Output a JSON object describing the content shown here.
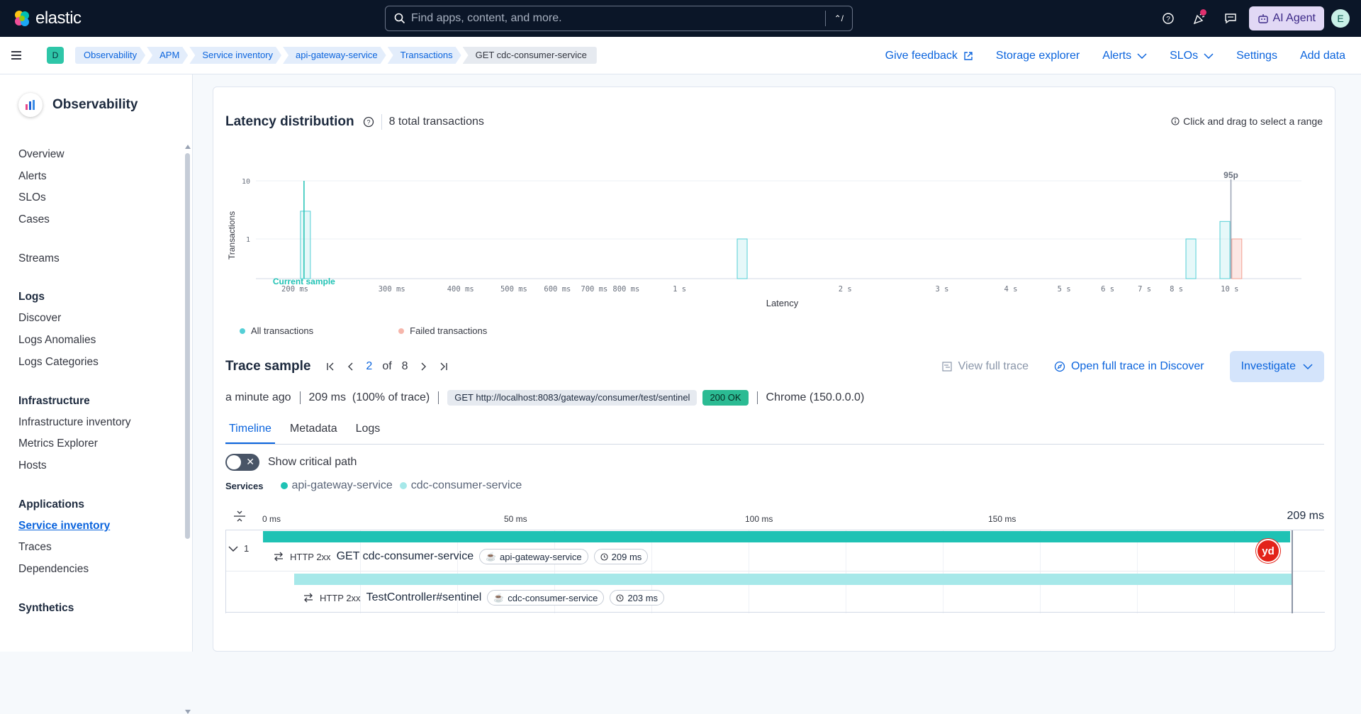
{
  "topbar": {
    "brand": "elastic",
    "search_placeholder": "Find apps, content, and more.",
    "search_shortcut": "⌃/",
    "ai_agent_label": "AI Agent",
    "avatar_initial": "E"
  },
  "subbar": {
    "space_initial": "D",
    "breadcrumbs": [
      "Observability",
      "APM",
      "Service inventory",
      "api-gateway-service",
      "Transactions",
      "GET cdc-consumer-service"
    ],
    "links": {
      "give_feedback": "Give feedback",
      "storage_explorer": "Storage explorer",
      "alerts": "Alerts",
      "slos": "SLOs",
      "settings": "Settings",
      "add_data": "Add data"
    }
  },
  "sidebar": {
    "title": "Observability",
    "items": {
      "overview": "Overview",
      "alerts": "Alerts",
      "slos": "SLOs",
      "cases": "Cases",
      "streams": "Streams",
      "logs_group": "Logs",
      "discover": "Discover",
      "logs_anomalies": "Logs Anomalies",
      "logs_categories": "Logs Categories",
      "infra_group": "Infrastructure",
      "infra_inventory": "Infrastructure inventory",
      "metrics_explorer": "Metrics Explorer",
      "hosts": "Hosts",
      "apps_group": "Applications",
      "service_inventory": "Service inventory",
      "traces": "Traces",
      "dependencies": "Dependencies",
      "synthetics_group": "Synthetics"
    }
  },
  "latency": {
    "title": "Latency distribution",
    "total": "8 total transactions",
    "hint": "Click and drag to select a range",
    "legend_all": "All transactions",
    "legend_failed": "Failed transactions"
  },
  "chart_data": {
    "type": "bar",
    "xlabel": "Latency",
    "ylabel": "Transactions",
    "y_scale": "log",
    "y_ticks": [
      "10",
      "1"
    ],
    "x_ticks": [
      "200 ms",
      "300 ms",
      "400 ms",
      "500 ms",
      "600 ms",
      "700 ms",
      "800 ms",
      "1 s",
      "2 s",
      "3 s",
      "4 s",
      "5 s",
      "6 s",
      "7 s",
      "8 s",
      "10 s"
    ],
    "annotations": {
      "current_sample": "Current sample",
      "percentile": "95p"
    },
    "series": [
      {
        "name": "All transactions",
        "color": "#54cfd6",
        "bins": [
          {
            "x_ms": 209,
            "count": 3
          },
          {
            "x_ms": 1300,
            "count": 1
          },
          {
            "x_ms": 8500,
            "count": 1
          },
          {
            "x_ms": 9800,
            "count": 2
          }
        ]
      },
      {
        "name": "Failed transactions",
        "color": "#f2a093",
        "bins": [
          {
            "x_ms": 10300,
            "count": 1
          }
        ]
      }
    ]
  },
  "trace_sample": {
    "title": "Trace sample",
    "current": "2",
    "of_label": "of",
    "total": "8",
    "view_full_trace": "View full trace",
    "open_discover": "Open full trace in Discover",
    "investigate": "Investigate",
    "when": "a minute ago",
    "duration": "209 ms",
    "pct": "(100% of trace)",
    "url": "GET http://localhost:8083/gateway/consumer/test/sentinel",
    "status": "200 OK",
    "agent": "Chrome (150.0.0.0)"
  },
  "tabs": [
    "Timeline",
    "Metadata",
    "Logs"
  ],
  "critical_path_label": "Show critical path",
  "services": {
    "label": "Services",
    "items": [
      {
        "name": "api-gateway-service",
        "color": "#1fc2b4"
      },
      {
        "name": "cdc-consumer-service",
        "color": "#a6e8e9"
      }
    ]
  },
  "timeline": {
    "ticks": [
      "0 ms",
      "50 ms",
      "100 ms",
      "150 ms"
    ],
    "end": "209 ms",
    "rows": [
      {
        "count": "1",
        "http": "HTTP 2xx",
        "name": "GET cdc-consumer-service",
        "service": "api-gateway-service",
        "duration": "209 ms",
        "start_ms": 0,
        "dur_ms": 209,
        "color": "#1fc2b4"
      },
      {
        "http": "HTTP 2xx",
        "name": "TestController#sentinel",
        "service": "cdc-consumer-service",
        "duration": "203 ms",
        "start_ms": 6.3,
        "dur_ms": 203,
        "color": "#a6e8e9"
      }
    ],
    "badge": "yd"
  }
}
